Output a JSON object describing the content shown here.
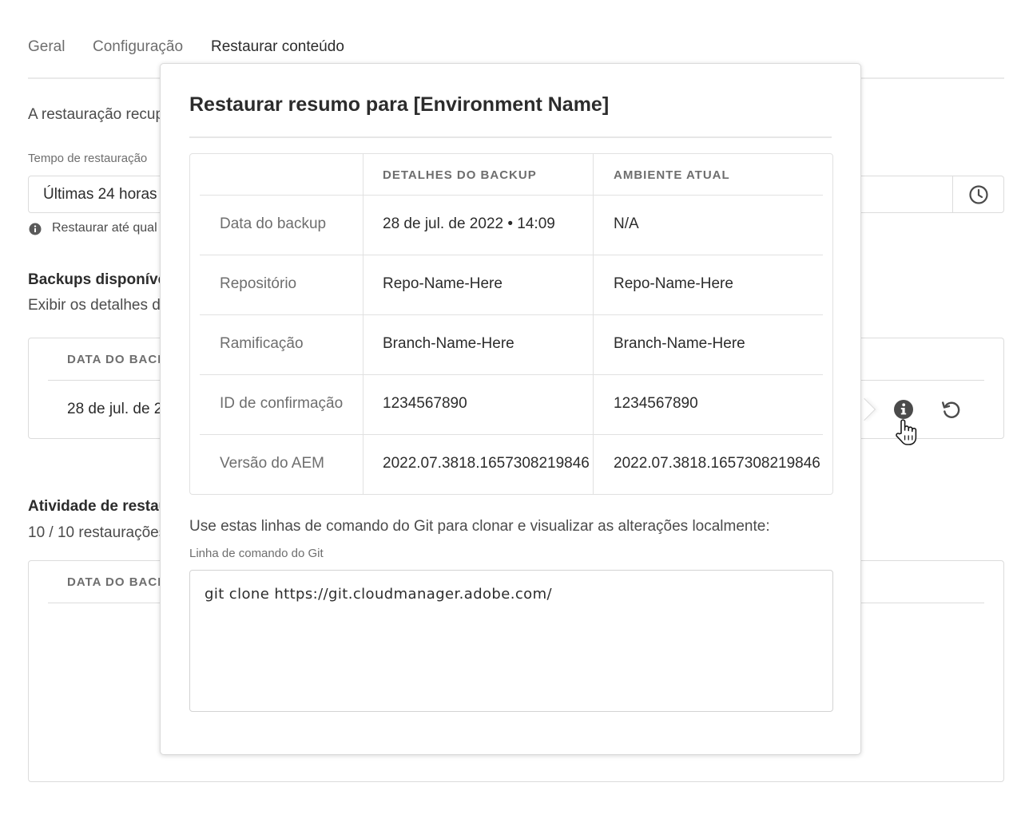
{
  "tabs": [
    "Geral",
    "Configuração",
    "Restaurar conteúdo"
  ],
  "intro_text": "A restauração recup",
  "restore_time": {
    "label": "Tempo de restauração",
    "value": "Últimas 24 horas",
    "helper": "Restaurar até qual"
  },
  "backups": {
    "title": "Backups disponíve",
    "subtitle": "Exibir os detalhes d",
    "column_header": "DATA DO BACK",
    "row_value": "28 de jul. de 2"
  },
  "activity": {
    "title": "Atividade de restau",
    "subtitle": "10 / 10 restaurações",
    "column_header": "DATA DO BACK"
  },
  "popover": {
    "title": "Restaurar resumo para [Environment Name]",
    "columns": [
      "",
      "DETALHES DO BACKUP",
      "AMBIENTE ATUAL"
    ],
    "rows": [
      {
        "label": "Data do backup",
        "backup": "28 de jul. de 2022 • 14:09",
        "current": "N/A"
      },
      {
        "label": "Repositório",
        "backup": "Repo-Name-Here",
        "current": "Repo-Name-Here"
      },
      {
        "label": "Ramificação",
        "backup": "Branch-Name-Here",
        "current": "Branch-Name-Here"
      },
      {
        "label": "ID de confirmação",
        "backup": "1234567890",
        "current": "1234567890"
      },
      {
        "label": "Versão do AEM",
        "backup": "2022.07.3818.1657308219846",
        "current": "2022.07.3818.1657308219846"
      }
    ],
    "git_intro": "Use estas linhas de comando do Git para clonar e visualizar as alterações localmente:",
    "git_label": "Linha de comando do Git",
    "git_command": "git clone https://git.cloudmanager.adobe.com/"
  },
  "icons": {
    "clock": "clock-icon",
    "info": "info-icon",
    "restore": "restore-icon",
    "cursor": "hand-cursor-icon"
  }
}
